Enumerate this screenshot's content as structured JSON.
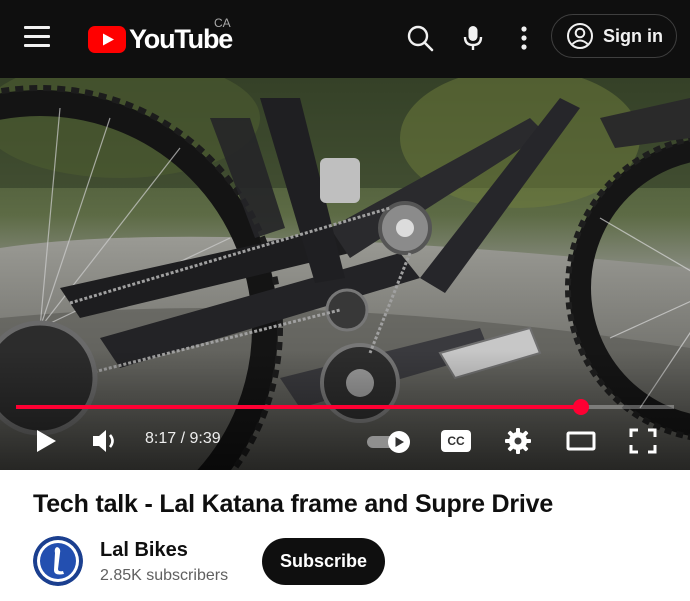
{
  "header": {
    "logo_text": "YouTube",
    "region": "CA",
    "menu_icon": "hamburger-menu-icon",
    "search_icon": "search-icon",
    "mic_icon": "microphone-icon",
    "more_icon": "more-vert-icon",
    "signin_label": "Sign in",
    "signin_icon": "account-circle-icon",
    "brand_color": "#ff0000"
  },
  "player": {
    "current_time": "8:17",
    "duration": "9:39",
    "time_display": "8:17 / 9:39",
    "progress_fraction": 0.858,
    "progress_color": "#ff0033",
    "autoplay_on": true,
    "controls": [
      "play-icon",
      "volume-icon",
      "autoplay-toggle",
      "captions-icon",
      "settings-gear-icon",
      "theater-mode-icon",
      "fullscreen-icon"
    ],
    "captions_label": "CC"
  },
  "video": {
    "title": "Tech talk - Lal Katana frame and Supre Drive",
    "channel_name": "Lal Bikes",
    "subscribers": "2.85K subscribers",
    "subscribe_label": "Subscribe"
  }
}
